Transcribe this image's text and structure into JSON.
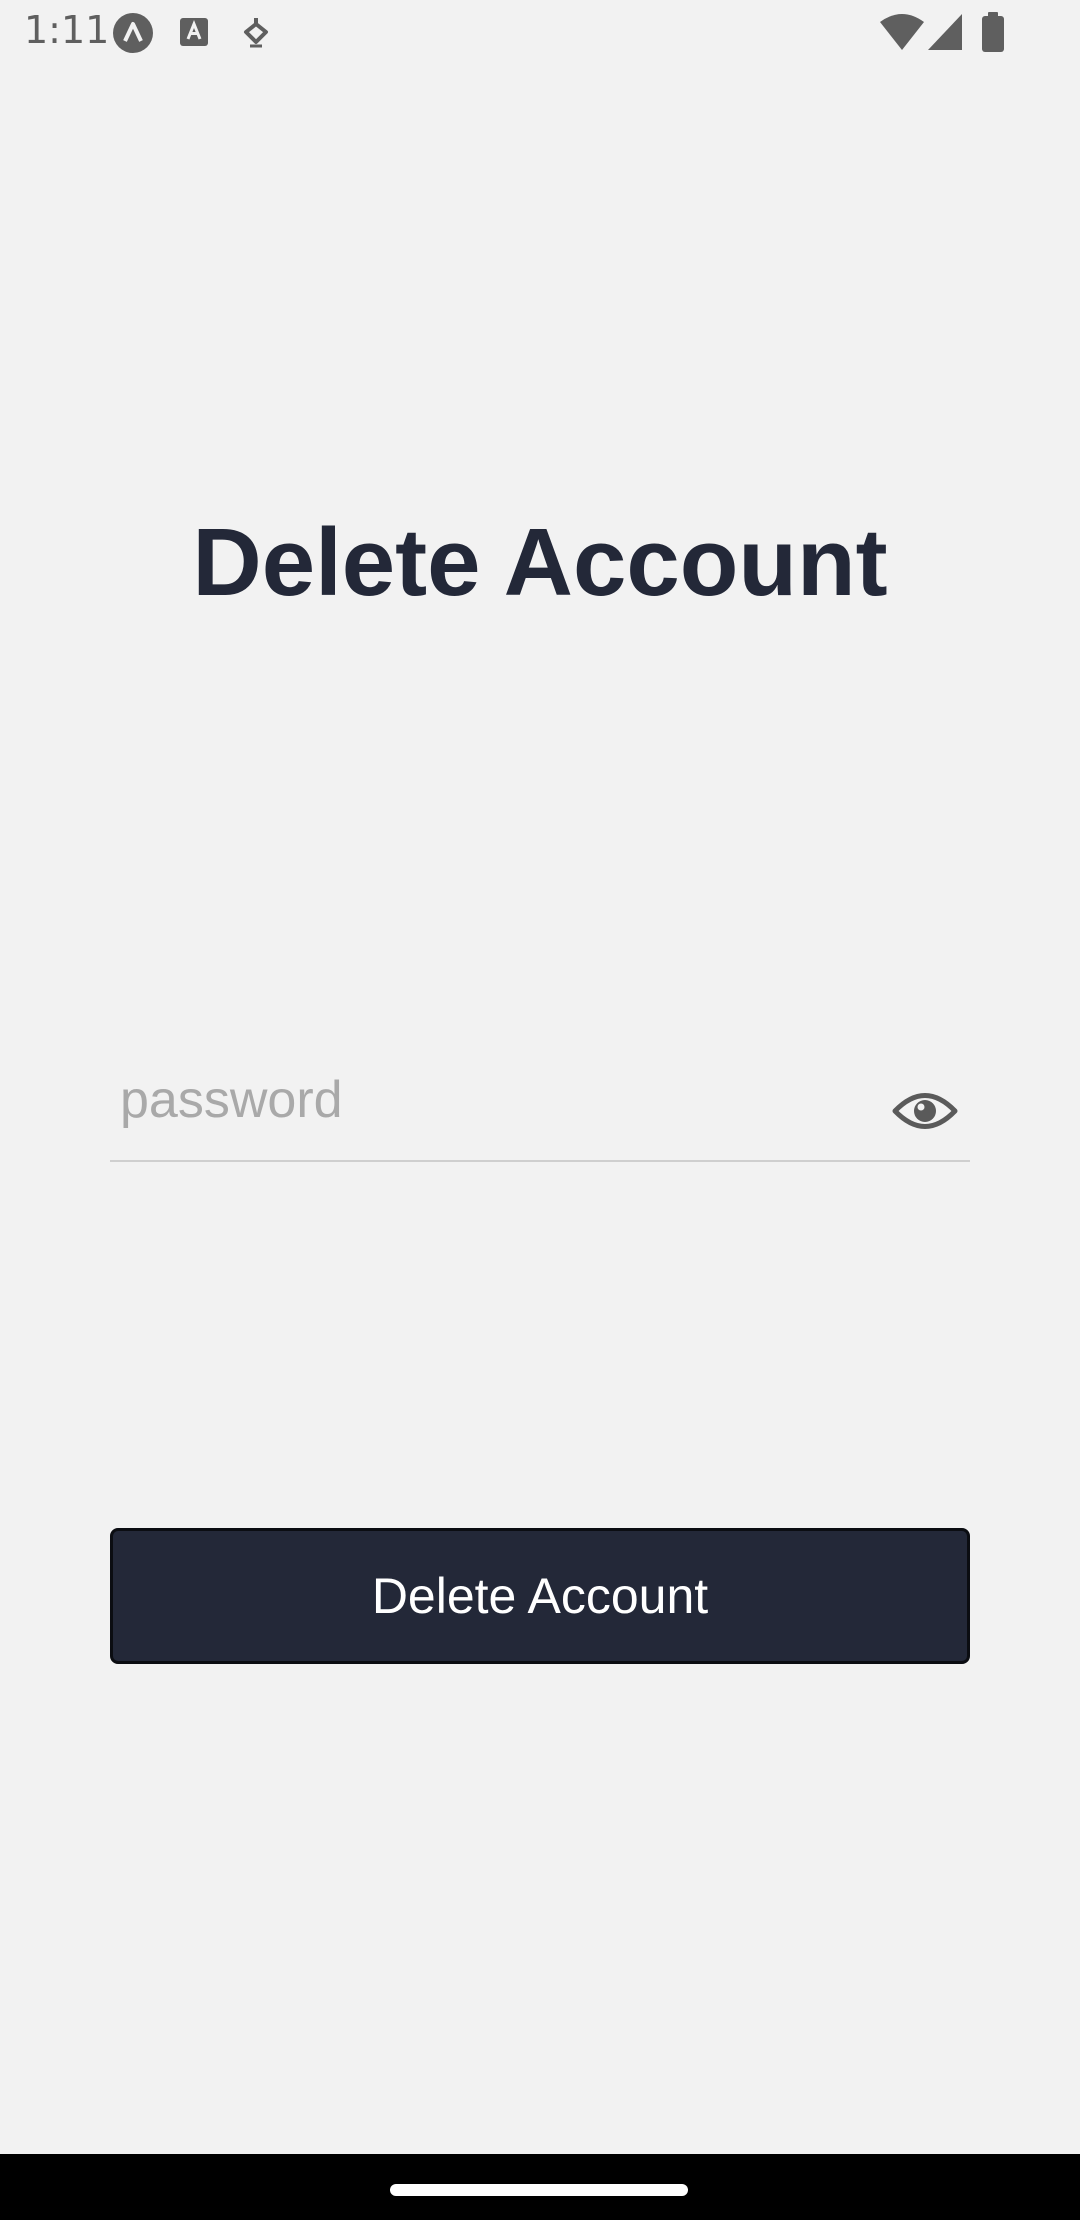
{
  "status_bar": {
    "time": "1:11",
    "left_icons": [
      "app-a-icon",
      "font-a-icon",
      "download-icon"
    ],
    "right_icons": [
      "wifi-icon",
      "cellular-signal-icon",
      "battery-icon"
    ]
  },
  "main": {
    "title": "Delete Account",
    "password_field": {
      "placeholder": "password",
      "value": "",
      "toggle_icon": "eye-icon"
    },
    "delete_button_label": "Delete Account"
  },
  "colors": {
    "background": "#f2f2f2",
    "primary_dark": "#232838",
    "placeholder": "#a9a9a9"
  }
}
